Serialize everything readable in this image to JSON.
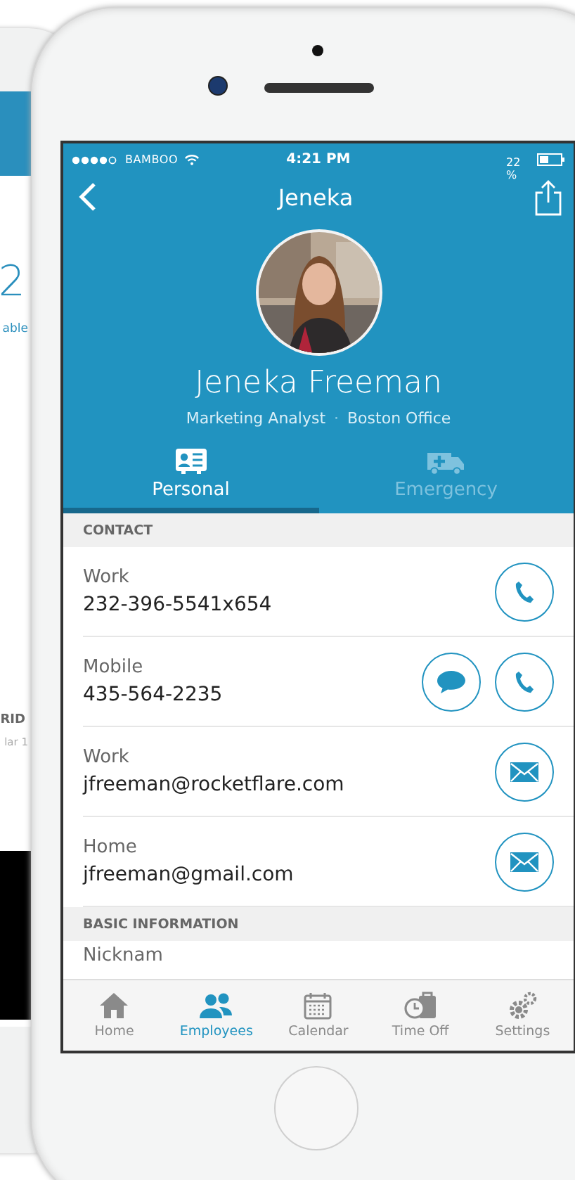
{
  "back_phone": {
    "texts": [
      {
        "kind": "big",
        "text": "2"
      },
      {
        "kind": "blue",
        "text": "able"
      },
      {
        "kind": "bold",
        "text": "RID"
      },
      {
        "kind": "grey",
        "text": "lar 1"
      }
    ]
  },
  "status_bar": {
    "carrier": "BAMBOO",
    "time": "4:21 PM",
    "battery": "22 %"
  },
  "nav": {
    "title": "Jeneka"
  },
  "profile": {
    "name": "Jeneka Freeman",
    "role": "Marketing Analyst",
    "separator": "·",
    "office": "Boston Office"
  },
  "tabs": [
    {
      "label": "Personal",
      "selected": true
    },
    {
      "label": "Emergency",
      "selected": false
    }
  ],
  "sections": [
    {
      "title": "CONTACT",
      "rows": [
        {
          "label": "Work",
          "value": "232-396-5541x654",
          "actions": [
            {
              "kind": "phone"
            }
          ]
        },
        {
          "label": "Mobile",
          "value": "435-564-2235",
          "actions": [
            {
              "kind": "chat"
            },
            {
              "kind": "phone"
            }
          ]
        },
        {
          "label": "Work",
          "value": "jfreeman@rocketflare.com",
          "actions": [
            {
              "kind": "mail"
            }
          ]
        },
        {
          "label": "Home",
          "value": "jfreeman@gmail.com",
          "actions": [
            {
              "kind": "mail"
            }
          ]
        }
      ]
    },
    {
      "title": "BASIC INFORMATION",
      "rows": [
        {
          "label": "Nicknam",
          "actions": []
        }
      ]
    }
  ],
  "bottom_nav": [
    {
      "label": "Home",
      "selected": false
    },
    {
      "label": "Employees",
      "selected": true
    },
    {
      "label": "Calendar",
      "selected": false
    },
    {
      "label": "Time Off",
      "selected": false
    },
    {
      "label": "Settings",
      "selected": false
    }
  ]
}
